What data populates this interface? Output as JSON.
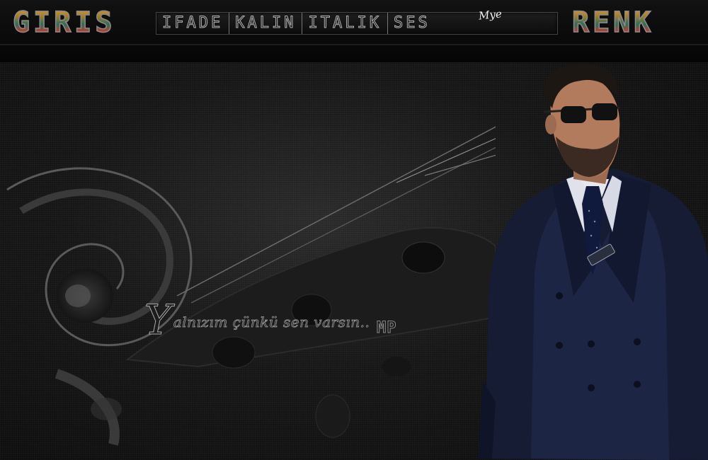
{
  "toolbar": {
    "left_button": "GIRIS",
    "right_button": "RENK",
    "menu": [
      "IFADE",
      "KALIN",
      "ITALIK",
      "SES"
    ],
    "signature": "Mye"
  },
  "banner": {
    "quote": "Yalnızım çünkü sen varsın..",
    "quote_initial": "Y",
    "quote_rest": "alnızım çünkü sen varsın..",
    "mark": "MP",
    "badge_text": "Mye"
  },
  "colors": {
    "background": "#0b0b0c",
    "suit": "#1b2340",
    "button_gradient": [
      "#d4a23c",
      "#2f6d5a",
      "#c43b2e"
    ]
  }
}
